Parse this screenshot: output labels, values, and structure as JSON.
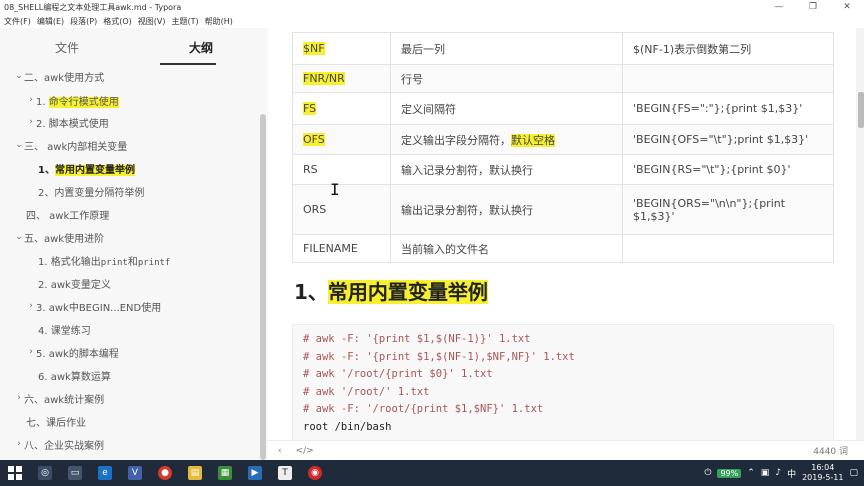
{
  "window": {
    "title": "08_SHELL编程之文本处理工具awk.md - Typora",
    "buttons": {
      "minimize": "—",
      "maximize": "❐",
      "close": "✕"
    }
  },
  "menu": [
    "文件(F)",
    "编辑(E)",
    "段落(P)",
    "格式(O)",
    "视图(V)",
    "主题(T)",
    "帮助(H)"
  ],
  "sidebar": {
    "tabs": {
      "files": "文件",
      "outline": "大纲"
    },
    "items": [
      {
        "caret": "⌄",
        "label": "二、awk使用方式"
      },
      {
        "caret": "›",
        "prefix": "1. ",
        "label": "命令行模式使用"
      },
      {
        "caret": "›",
        "label": "2. 脚本模式使用"
      },
      {
        "caret": "⌄",
        "label": "三、 awk内部相关变量"
      },
      {
        "caret": "",
        "prefix": "1、",
        "label": "常用内置变量举例"
      },
      {
        "caret": "",
        "label": "2、内置变量分隔符举例"
      },
      {
        "caret": "",
        "label": "四、 awk工作原理"
      },
      {
        "caret": "⌄",
        "label": "五、awk使用进阶"
      },
      {
        "caret": "",
        "label_a": "1. 格式化输出",
        "code_a": "print",
        "label_b": "和",
        "code_b": "printf"
      },
      {
        "caret": "",
        "label": "2. awk变量定义"
      },
      {
        "caret": "›",
        "label": "3. awk中BEGIN...END使用"
      },
      {
        "caret": "",
        "label": "4. 课堂练习"
      },
      {
        "caret": "›",
        "label": "5. awk的脚本编程"
      },
      {
        "caret": "",
        "label": "6. awk算数运算"
      },
      {
        "caret": "›",
        "label": "六、awk统计案例"
      },
      {
        "caret": "",
        "label": "七、课后作业"
      },
      {
        "caret": "›",
        "label": "八、企业实战案例"
      }
    ]
  },
  "table": {
    "rows": [
      {
        "var": "$NF",
        "desc": "最后一列",
        "example": "$(NF-1)表示倒数第二列"
      },
      {
        "var": "FNR/NR",
        "desc": "行号",
        "example": ""
      },
      {
        "var": "FS",
        "desc": "定义间隔符",
        "example": "'BEGIN{FS=\":\"};{print $1,$3}'"
      },
      {
        "var": "OFS",
        "desc": "定义输出字段分隔符，",
        "desc_hl": "默认空格",
        "example": "'BEGIN{OFS=\"\\t\"};print $1,$3}'"
      },
      {
        "var": "RS",
        "desc": "输入记录分割符，默认换行",
        "example": "'BEGIN{RS=\"\\t\"};{print $0}'"
      },
      {
        "var": "ORS",
        "desc": "输出记录分割符，默认换行",
        "example": "'BEGIN{ORS=\"\\n\\n\"};{print $1,$3}'"
      },
      {
        "var": "FILENAME",
        "desc": "当前输入的文件名",
        "example": ""
      }
    ]
  },
  "heading": {
    "prefix": "1、",
    "text": "常用内置变量举例"
  },
  "code": [
    "# awk -F: '{print $1,$(NF-1)}' 1.txt",
    "# awk -F: '{print $1,$(NF-1),$NF,NF}' 1.txt",
    "# awk '/root/{print $0}' 1.txt",
    "# awk '/root/' 1.txt",
    "# awk -F: '/root/{print $1,$NF}' 1.txt",
    "root /bin/bash"
  ],
  "status": {
    "left_icon": "‹",
    "source_icon": "</>",
    "word_count": "4440 词"
  },
  "taskbar": {
    "battery": "99%",
    "time": "16:04",
    "date": "2019-5-11"
  }
}
